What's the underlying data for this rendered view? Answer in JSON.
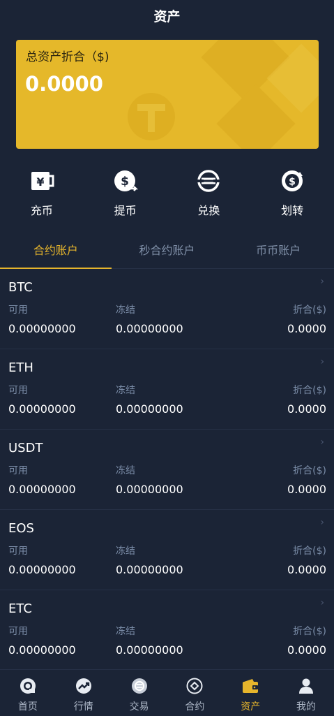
{
  "header": {
    "title": "资产"
  },
  "card": {
    "label": "总资产折合（$)",
    "value": "0.0000"
  },
  "actions": [
    {
      "label": "充币",
      "icon": "deposit-icon"
    },
    {
      "label": "提币",
      "icon": "withdraw-icon"
    },
    {
      "label": "兑换",
      "icon": "exchange-icon"
    },
    {
      "label": "划转",
      "icon": "transfer-icon"
    }
  ],
  "tabs": [
    {
      "label": "合约账户",
      "active": true
    },
    {
      "label": "秒合约账户",
      "active": false
    },
    {
      "label": "币币账户",
      "active": false
    }
  ],
  "columns": {
    "available": "可用",
    "frozen": "冻结",
    "converted": "折合($)"
  },
  "assets": [
    {
      "name": "BTC",
      "available": "0.00000000",
      "frozen": "0.00000000",
      "converted": "0.0000"
    },
    {
      "name": "ETH",
      "available": "0.00000000",
      "frozen": "0.00000000",
      "converted": "0.0000"
    },
    {
      "name": "USDT",
      "available": "0.00000000",
      "frozen": "0.00000000",
      "converted": "0.0000"
    },
    {
      "name": "EOS",
      "available": "0.00000000",
      "frozen": "0.00000000",
      "converted": "0.0000"
    },
    {
      "name": "ETC",
      "available": "0.00000000",
      "frozen": "0.00000000",
      "converted": "0.0000"
    }
  ],
  "nav": [
    {
      "label": "首页",
      "icon": "home-icon",
      "active": false
    },
    {
      "label": "行情",
      "icon": "market-icon",
      "active": false
    },
    {
      "label": "交易",
      "icon": "trade-icon",
      "active": false
    },
    {
      "label": "合约",
      "icon": "contract-icon",
      "active": false
    },
    {
      "label": "资产",
      "icon": "wallet-icon",
      "active": true
    },
    {
      "label": "我的",
      "icon": "profile-icon",
      "active": false
    }
  ],
  "colors": {
    "accent": "#e6b52c",
    "background": "#1b2436",
    "card": "#e5b82a"
  }
}
